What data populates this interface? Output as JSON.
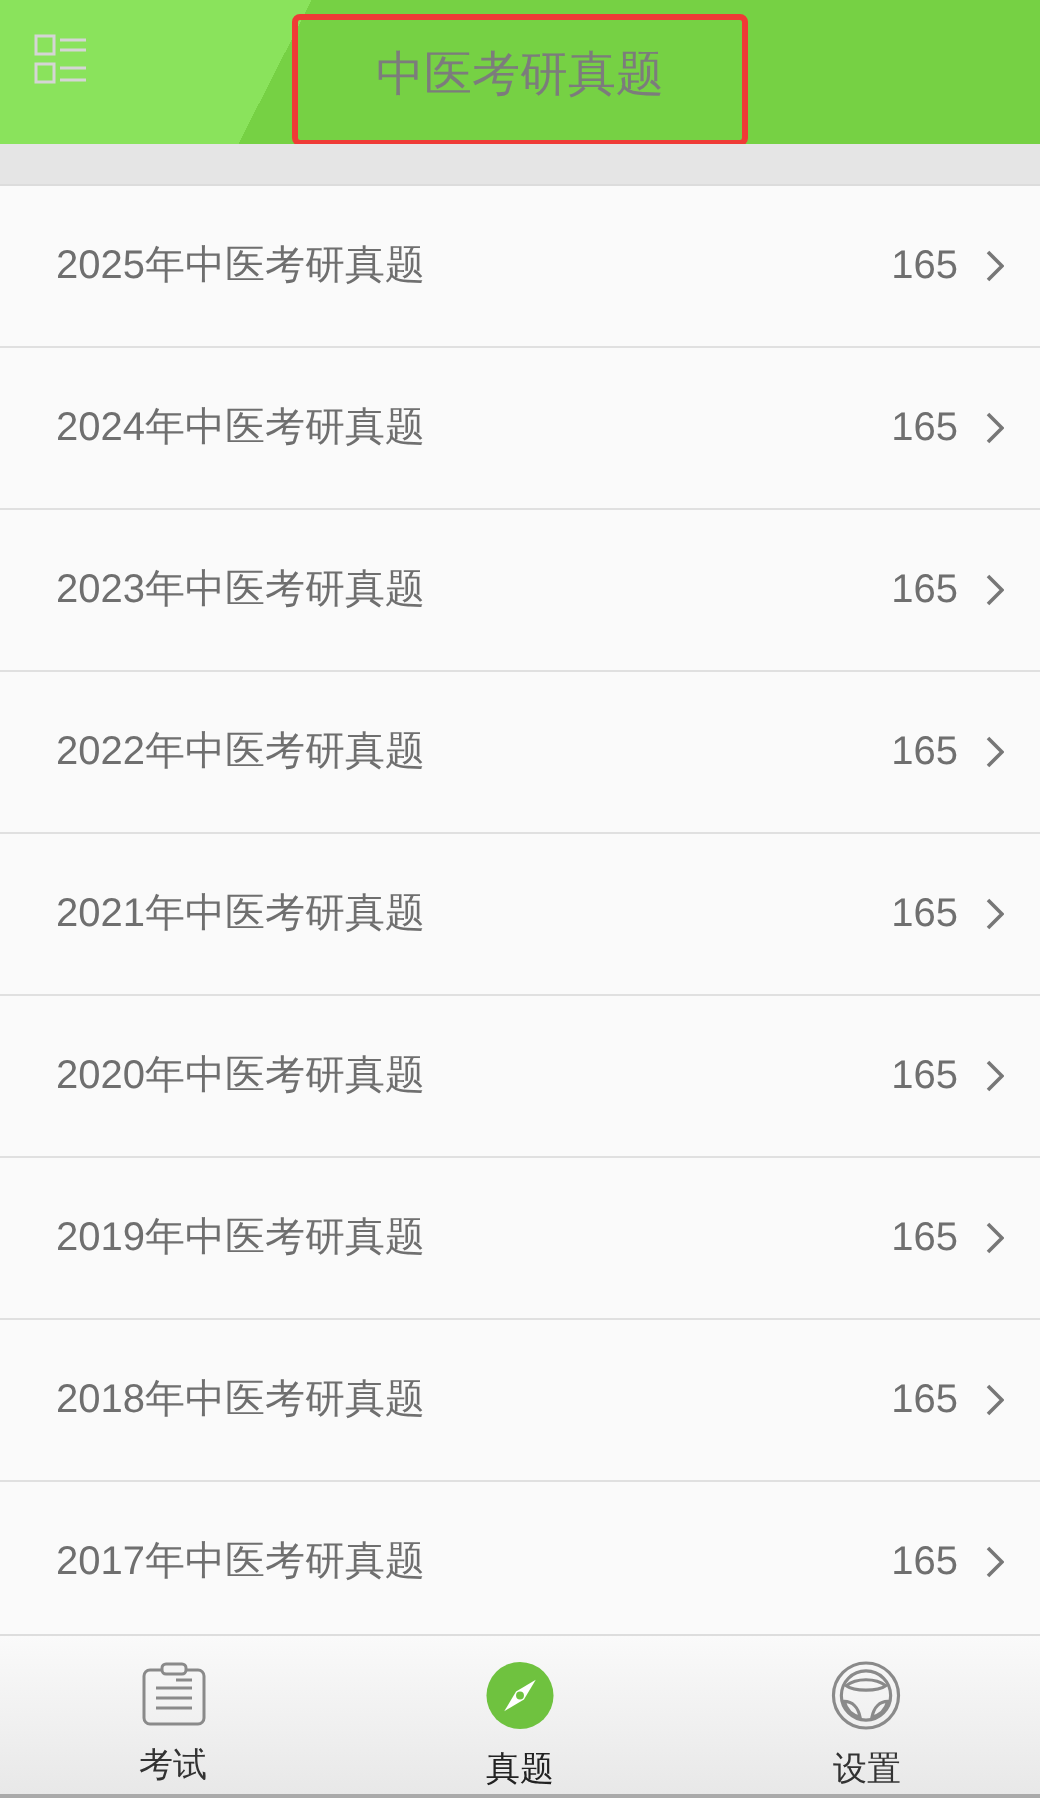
{
  "header": {
    "title": "中医考研真题",
    "title_highlighted": true
  },
  "items": [
    {
      "label": "2025年中医考研真题",
      "count": "165"
    },
    {
      "label": "2024年中医考研真题",
      "count": "165"
    },
    {
      "label": "2023年中医考研真题",
      "count": "165"
    },
    {
      "label": "2022年中医考研真题",
      "count": "165"
    },
    {
      "label": "2021年中医考研真题",
      "count": "165"
    },
    {
      "label": "2020年中医考研真题",
      "count": "165"
    },
    {
      "label": "2019年中医考研真题",
      "count": "165"
    },
    {
      "label": "2018年中医考研真题",
      "count": "165"
    },
    {
      "label": "2017年中医考研真题",
      "count": "165"
    }
  ],
  "tabs": [
    {
      "label": "考试",
      "kind": "exam",
      "selected": false
    },
    {
      "label": "真题",
      "kind": "compass",
      "selected": true
    },
    {
      "label": "设置",
      "kind": "wheel",
      "selected": false
    }
  ]
}
